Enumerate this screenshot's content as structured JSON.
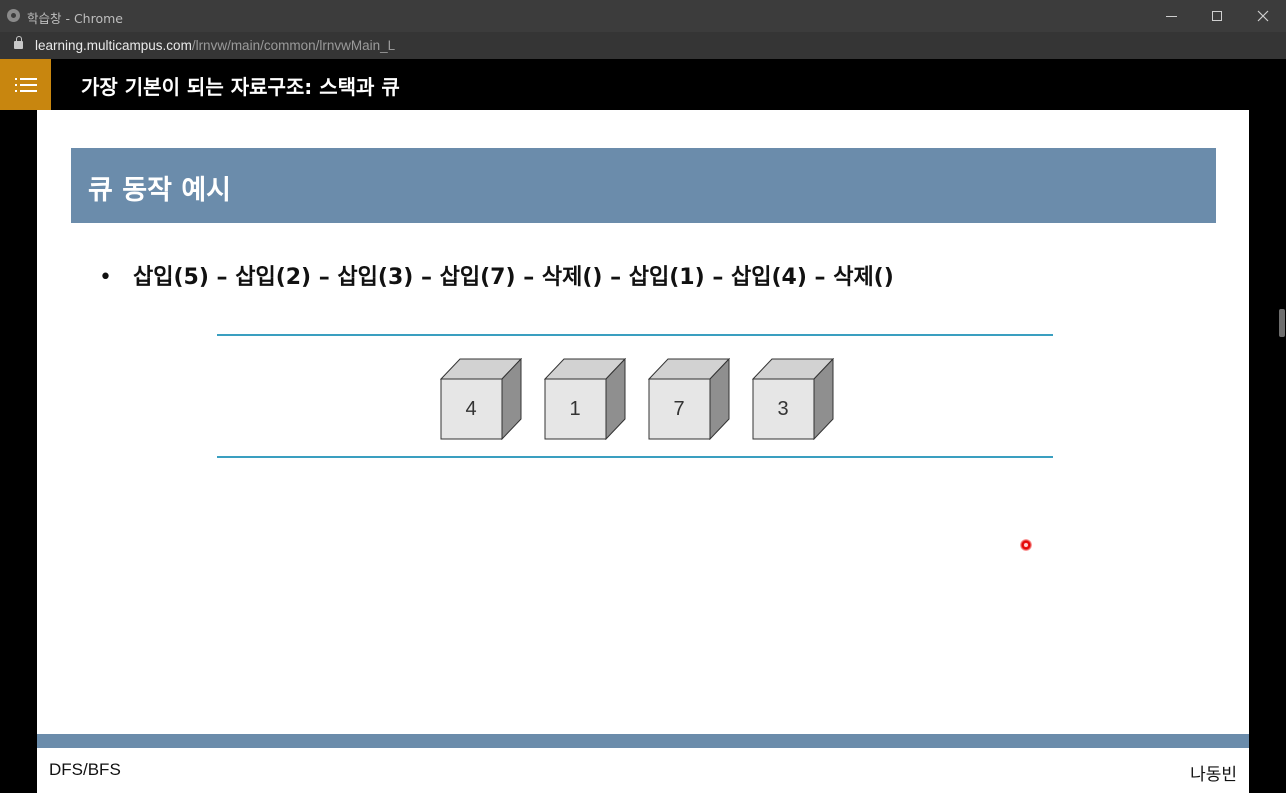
{
  "window": {
    "title": "학습창 - Chrome"
  },
  "address_bar": {
    "host": "learning.multicampus.com",
    "path": "/lrnvw/main/common/lrnvwMain_L"
  },
  "course": {
    "title": "가장 기본이 되는 자료구조: 스택과 큐"
  },
  "slide": {
    "title": "큐 동작 예시",
    "bullet_marker": "•",
    "bullet_text": "삽입(5) – 삽입(2) – 삽입(3) – 삽입(7) – 삭제() – 삽입(1) – 삽입(4) – 삭제()",
    "queue_items": [
      "4",
      "1",
      "7",
      "3"
    ],
    "footer_left": "DFS/BFS",
    "footer_right": "나동빈"
  },
  "colors": {
    "menu_button": "#c8860f",
    "slide_header": "#6b8cab",
    "queue_rail": "#3a9fc0",
    "cursor_dot": "#e00000"
  },
  "icons": {
    "menu": "list-icon",
    "lock": "lock-icon",
    "app": "chrome-app-icon"
  }
}
